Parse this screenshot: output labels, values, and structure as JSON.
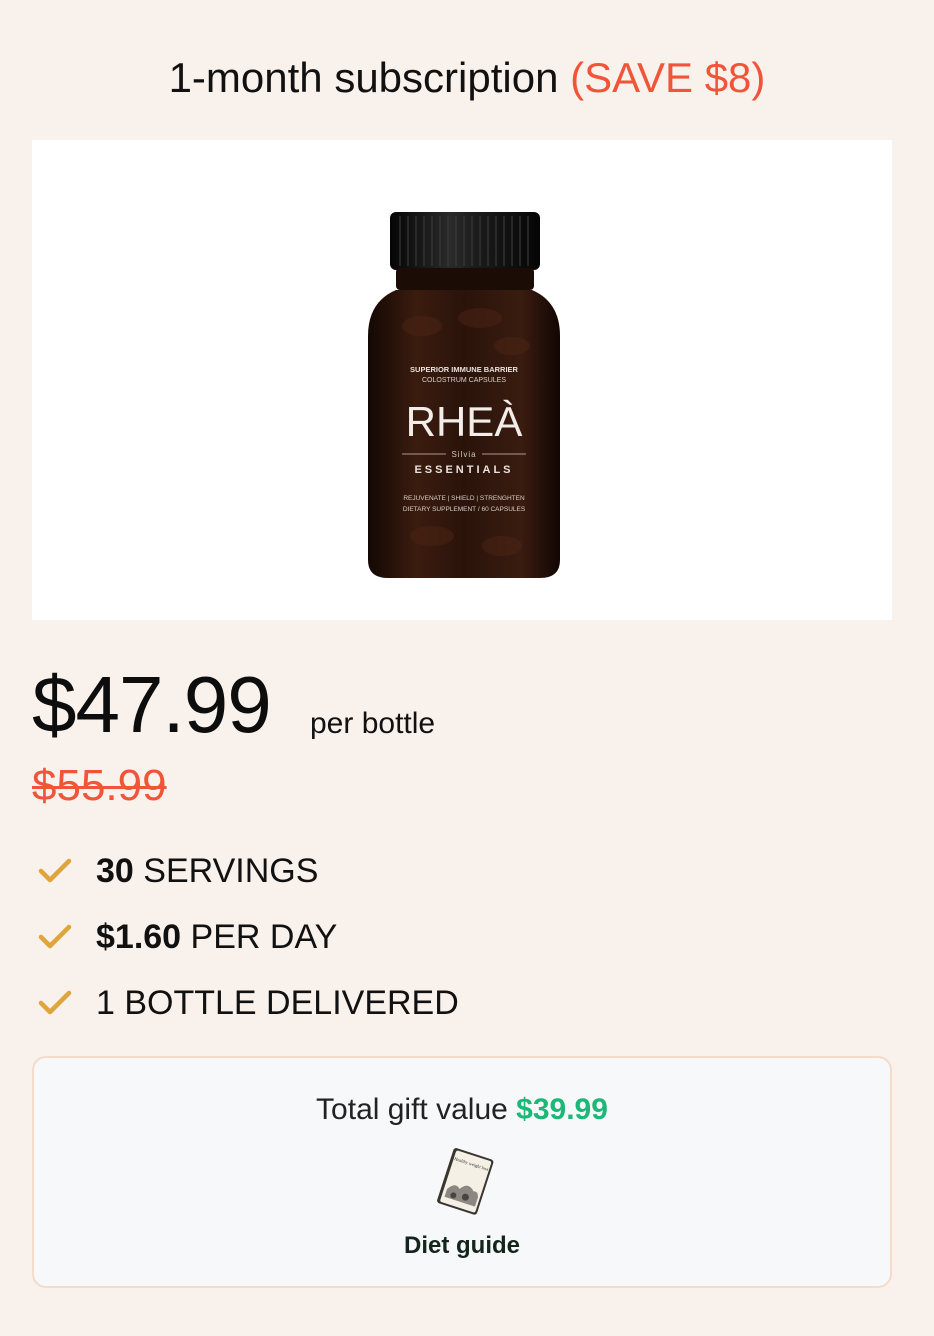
{
  "header": {
    "title": "1-month subscription",
    "savings": "(SAVE $8)"
  },
  "product": {
    "image_alt": "RHEÀ Silvia Essentials colostrum capsules bottle",
    "label": {
      "top_line1": "SUPERIOR IMMUNE BARRIER",
      "top_line2": "COLOSTRUM CAPSULES",
      "brand": "RHEÀ",
      "sub_brand": "Silvia",
      "line": "ESSENTIALS",
      "bottom_line1": "REJUVENATE  |  SHIELD  |  STRENGHTEN",
      "bottom_line2": "DIETARY SUPPLEMENT  /  60 CAPSULES"
    }
  },
  "pricing": {
    "price": "$47.99",
    "unit": "per bottle",
    "original_price": "$55.99"
  },
  "features": [
    {
      "bold": "30",
      "text": " SERVINGS",
      "icon": "check-icon"
    },
    {
      "bold": "$1.60",
      "text": " PER DAY",
      "icon": "check-icon"
    },
    {
      "bold": "",
      "text": "1 BOTTLE DELIVERED",
      "icon": "check-icon"
    }
  ],
  "gift": {
    "label": "Total gift value",
    "value": "$39.99",
    "item_label": "Diet guide",
    "item_icon": "booklet-icon",
    "item_cover_text": "Healthy weight loss"
  },
  "colors": {
    "background": "#f9f1ec",
    "accent_red": "#f0553a",
    "check_gold": "#e0a53a",
    "gift_green": "#1db877"
  }
}
